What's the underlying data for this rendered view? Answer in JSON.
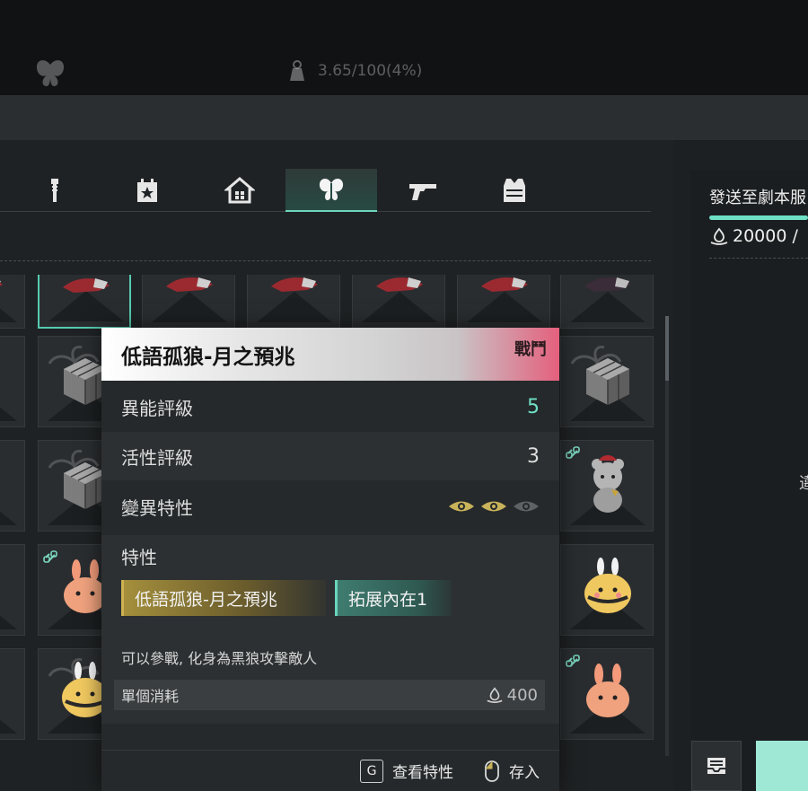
{
  "top": {
    "weight_text": "3.65/100(4%)",
    "icons": [
      "butterfly-icon",
      "weight-icon"
    ]
  },
  "tabs": [
    {
      "name": "tab-tools",
      "icon": "wrench-icon",
      "active": false
    },
    {
      "name": "tab-calendar",
      "icon": "calendar-star-icon",
      "active": false
    },
    {
      "name": "tab-home",
      "icon": "house-icon",
      "active": false
    },
    {
      "name": "tab-deviation",
      "icon": "butterfly-icon",
      "active": true
    },
    {
      "name": "tab-weapons",
      "icon": "pistol-icon",
      "active": false
    },
    {
      "name": "tab-armor",
      "icon": "vest-icon",
      "active": false
    }
  ],
  "right_panel": {
    "title": "發送至劇本服",
    "cost": "20000 /",
    "glyph": "違"
  },
  "tooltip": {
    "name": "低語孤狼-月之預兆",
    "category": "戰鬥",
    "rows": [
      {
        "label": "異能評級",
        "value": "5",
        "color": "#6ee0c6"
      },
      {
        "label": "活性評級",
        "value": "3",
        "color": "#f0f0f0"
      },
      {
        "label": "變異特性",
        "eyes_filled": 2,
        "eyes_total": 3
      }
    ],
    "traits_label": "特性",
    "traits": [
      "低語孤狼-月之預兆",
      "拓展內在1"
    ],
    "description": "可以參戰, 化身為黑狼攻擊敵人",
    "unit_cost_label": "單個消耗",
    "unit_cost_value": "400",
    "footer": {
      "key_g": "G",
      "view_traits": "查看特性",
      "store": "存入"
    }
  },
  "colors": {
    "accent": "#6ee0c6",
    "gold": "#cfb150",
    "header_pink": "#e4607d"
  }
}
